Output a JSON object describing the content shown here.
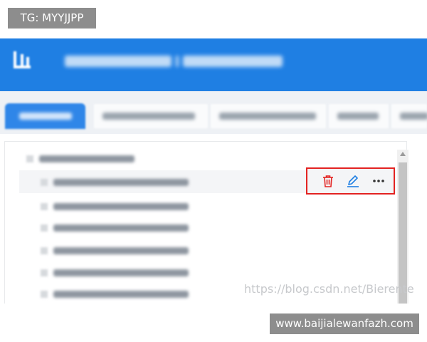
{
  "overlay": {
    "tg_label": "TG: MYYJJPP",
    "site_label": "www.baijialewanfazh.com"
  },
  "watermark": {
    "text": "https://blog.csdn.net/Bierente"
  },
  "colors": {
    "header_bg": "#1f7fe3",
    "tab_active": "#2f86e8",
    "highlight_border": "#e32322",
    "delete_icon": "#e32322",
    "edit_icon": "#1f7fe3",
    "more_icon": "#333333"
  },
  "actions": [
    {
      "icon": "trash-icon"
    },
    {
      "icon": "pencil-icon"
    },
    {
      "icon": "more-dots-icon"
    }
  ]
}
